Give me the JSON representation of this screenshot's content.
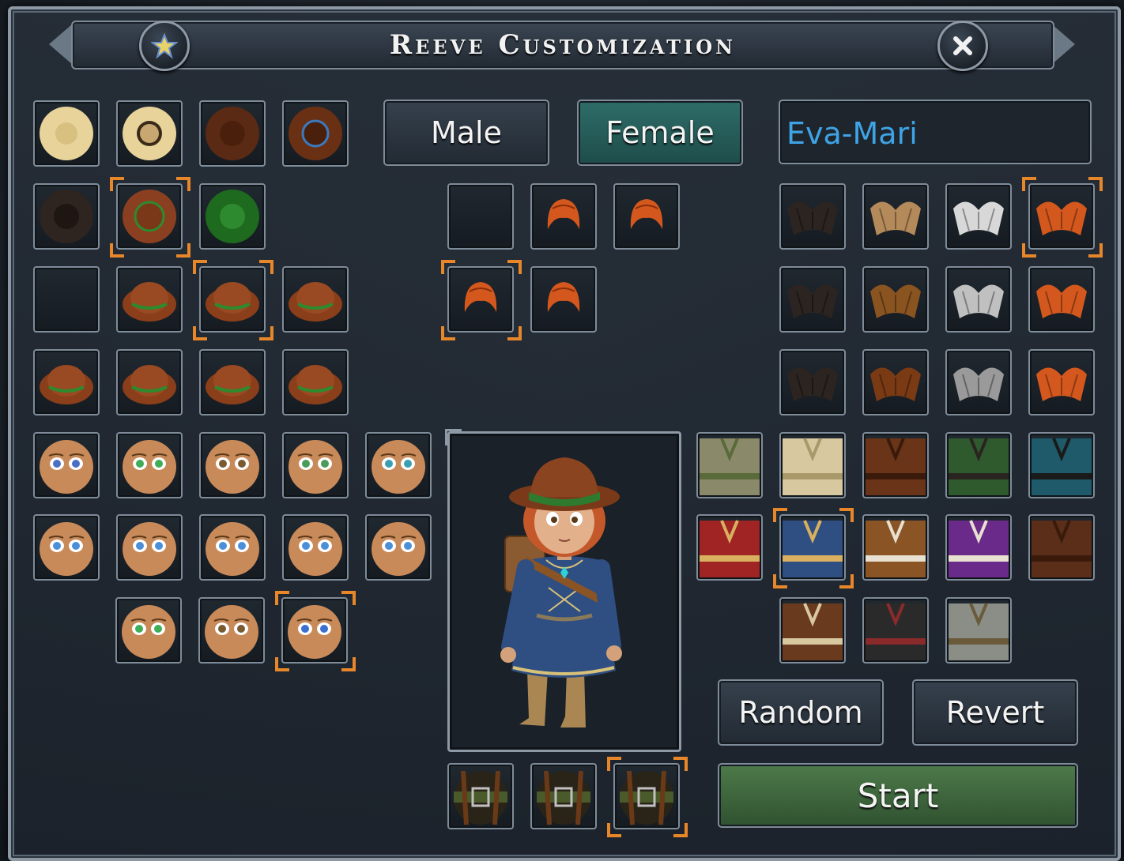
{
  "window": {
    "title": "Reeve Customization"
  },
  "gender": {
    "male_label": "Male",
    "female_label": "Female",
    "selected": "Female"
  },
  "name_field": {
    "value": "Eva-Mari"
  },
  "actions": {
    "random_label": "Random",
    "revert_label": "Revert",
    "start_label": "Start"
  },
  "icons": {
    "favorite": "star-icon",
    "close": "close-icon"
  },
  "colors": {
    "accent_selected": "#e8872a",
    "female_active": "#2e6c68",
    "start_button": "#4e7a4a",
    "name_text": "#3ea4e6"
  },
  "hats": {
    "rows": [
      [
        "straw-hat-light",
        "straw-hat-dark-band",
        "brown-cap",
        "brown-cap-blue-band"
      ],
      [
        "dark-cap",
        "brown-cap-green-band",
        "green-cap"
      ],
      [
        "empty",
        "brown-brim-green-band",
        "brown-dome-green-band",
        "brown-small-green-band"
      ],
      [
        "brown-wide-green-band",
        "brown-round-green-band",
        "brown-tall-green-band",
        "brown-low-green-band"
      ]
    ],
    "selected": [
      "1-1",
      "2-2"
    ]
  },
  "faces": {
    "eye_colors": [
      [
        "#4b6fc4",
        "#3fae57",
        "#7a5a30",
        "#4b9b5a",
        "#3a9fb0"
      ],
      [
        "#4b8fd8",
        "#4b8fd8",
        "#4b8fd8",
        "#4b8fd8",
        "#4b8fd8"
      ],
      [
        "#3fae57",
        "#7a5a30",
        "#3c6fd0"
      ]
    ],
    "selected": "2-2"
  },
  "hair_styles": {
    "rows": [
      [
        "none",
        "bun-short",
        "bob"
      ],
      [
        "ponytail",
        "braid"
      ]
    ],
    "selected": "1-0"
  },
  "hair_colors": {
    "rows": [
      [
        "#2c2420",
        "#b58a5a",
        "#d8d8d8",
        "#d4581e"
      ],
      [
        "#2c2420",
        "#8a5420",
        "#c0c0c0",
        "#d4581e"
      ],
      [
        "#2c2420",
        "#7a3a14",
        "#9a9a9a",
        "#d4581e"
      ]
    ],
    "selected": "0-3"
  },
  "outfits": {
    "rows": [
      [
        "green-tunic",
        "cream-laced-shirt",
        "brown-vest",
        "green-striped",
        "teal-striped"
      ],
      [
        "red-dress",
        "blue-dress",
        "brown-white-vest",
        "purple-robe",
        "brown-coat"
      ],
      [
        "brown-laced-vest",
        "black-vest",
        "grey-tunic"
      ]
    ],
    "selected": "1-1"
  },
  "belts": {
    "items": [
      "belt-a",
      "belt-b",
      "belt-c"
    ],
    "selected": 2
  }
}
